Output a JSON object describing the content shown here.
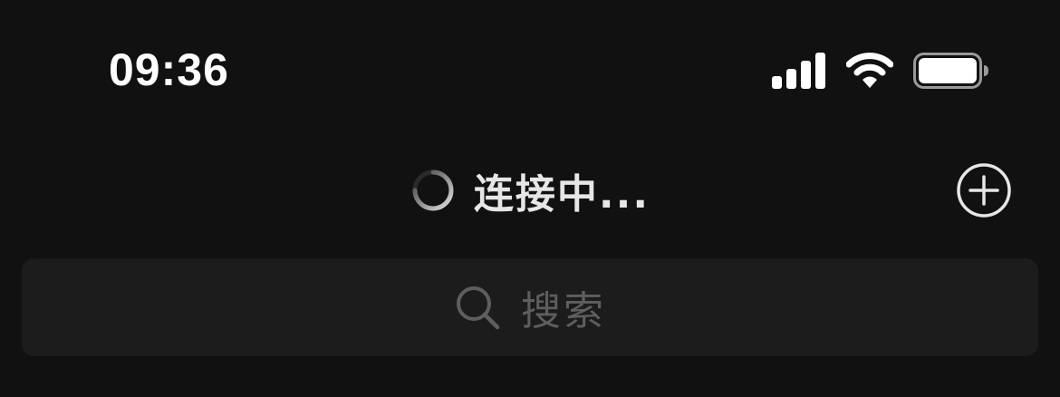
{
  "status_bar": {
    "time": "09:36",
    "icons": [
      "signal-icon",
      "wifi-icon",
      "battery-icon"
    ]
  },
  "nav": {
    "title": "连接中...",
    "spinner": "spinner-icon",
    "add_icon": "plus-circle-icon"
  },
  "search": {
    "placeholder": "搜索",
    "icon": "search-icon"
  },
  "colors": {
    "background": "#111111",
    "search_background": "#1c1c1c",
    "title_text": "#e6e6e6",
    "placeholder_text": "#5e5e5e"
  }
}
